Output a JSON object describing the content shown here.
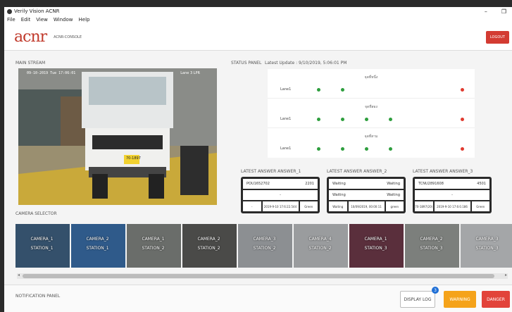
{
  "window": {
    "title": "Verily Vision ACNR",
    "minimize": "–",
    "restore": "❐"
  },
  "menu": [
    "File",
    "Edit",
    "View",
    "Window",
    "Help"
  ],
  "header": {
    "brand": "acnr",
    "subtitle": "ACNR-CONSOLE",
    "logout": "LOGOUT"
  },
  "main_stream": {
    "label": "MAIN STREAM",
    "timestamp": "09-10-2019 Tue 17:06:01",
    "lane_overlay": "Lane 3 LPR",
    "plate": "70-1897"
  },
  "status_panel": {
    "label": "STATUS PANEL",
    "latest_update": "Latest Update : 9/10/2019, 5:06:01 PM",
    "groups": [
      {
        "title": "จุดที่หนึ่ง",
        "lane": "Lane1",
        "dots": [
          "green",
          "green",
          "red"
        ]
      },
      {
        "title": "จุดที่สอง",
        "lane": "Lane1",
        "dots": [
          "green",
          "green",
          "green",
          "green",
          "red"
        ]
      },
      {
        "title": "จุดที่สาม",
        "lane": "Lane1",
        "dots": [
          "green",
          "green",
          "green",
          "green",
          "red"
        ]
      }
    ]
  },
  "answers": [
    {
      "title": "LATEST ANSWER ANSWER_1",
      "plate": "POU1652702",
      "code": "2201",
      "sub": "-",
      "cells": [
        "-",
        "2019-9-10 17:6:22.544",
        "Green"
      ]
    },
    {
      "title": "LATEST ANSWER ANSWER_2",
      "plate": "Waiting",
      "code": "Waiting",
      "sub": "Waiting",
      "sub2": "Waiting",
      "cells": [
        "Waiting",
        "10/09/2019, 00:00:11",
        "green"
      ]
    },
    {
      "title": "LATEST ANSWER ANSWER_3",
      "plate": "TCNU2891608",
      "code": "4501",
      "sub": "-",
      "cells": [
        "70-1897(20)",
        "2019-9-10 17:6:0.186",
        "Green"
      ]
    }
  ],
  "camera_selector": {
    "label": "CAMERA SELECTOR",
    "cams": [
      {
        "cam": "CAMERA_1",
        "station": "STATION_1",
        "bg": "#34506b"
      },
      {
        "cam": "CAMERA_2",
        "station": "STATION_1",
        "bg": "#2f5a8a"
      },
      {
        "cam": "CAMERA_1",
        "station": "STATION_2",
        "bg": "#6a6d6a"
      },
      {
        "cam": "CAMERA_2",
        "station": "STATION_2",
        "bg": "#4a4a48"
      },
      {
        "cam": "CAMERA_3",
        "station": "STATION_2",
        "bg": "#8c8f92"
      },
      {
        "cam": "CAMERA_4",
        "station": "STATION_2",
        "bg": "#9a9c9e"
      },
      {
        "cam": "CAMERA_1",
        "station": "STATION_3",
        "bg": "#5a2f3c"
      },
      {
        "cam": "CAMERA_2",
        "station": "STATION_3",
        "bg": "#7c7f7c"
      },
      {
        "cam": "CAMERA_3",
        "station": "STATION_3",
        "bg": "#a4a6a8"
      }
    ]
  },
  "notification": {
    "label": "NOTIFICATION PANEL",
    "display_log": "DISPLAY LOG",
    "badge": "3",
    "warning": "WARNING",
    "danger": "DANGER"
  },
  "colors": {
    "green": "#2e9e3e",
    "red": "#e03a2f",
    "warning": "#f5a31a",
    "danger": "#e2433a",
    "badge": "#1f6fd6"
  }
}
